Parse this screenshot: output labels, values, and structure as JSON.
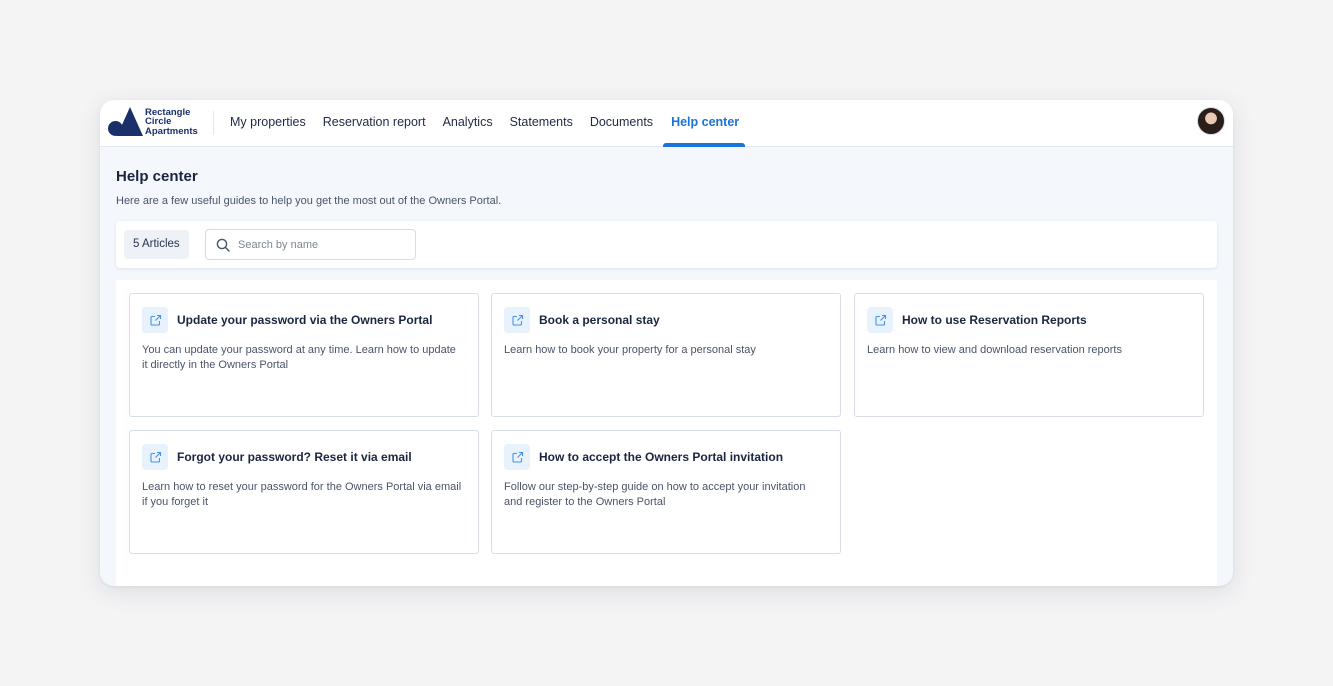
{
  "brand": {
    "logo_lines": [
      "Rectangle",
      "Circle",
      "Apartments"
    ],
    "color": "#1b2f6b"
  },
  "nav": {
    "items": [
      {
        "label": "My properties"
      },
      {
        "label": "Reservation report"
      },
      {
        "label": "Analytics"
      },
      {
        "label": "Statements"
      },
      {
        "label": "Documents"
      },
      {
        "label": "Help center",
        "active": true
      }
    ],
    "accent": "#1a73d9"
  },
  "page": {
    "title": "Help center",
    "subtitle": "Here are a few useful guides to help you get the most out of the Owners Portal."
  },
  "toolbar": {
    "count_label": "5 Articles",
    "search_placeholder": "Search by name",
    "search_value": ""
  },
  "articles": [
    {
      "title": "Update your password via the Owners Portal",
      "description": "You can update your password at any time. Learn how to update it directly in the Owners Portal",
      "icon": "external-link-icon"
    },
    {
      "title": "Book a personal stay",
      "description": "Learn how to book your property for a personal stay",
      "icon": "external-link-icon"
    },
    {
      "title": "How to use Reservation Reports",
      "description": "Learn how to view and download reservation reports",
      "icon": "external-link-icon"
    },
    {
      "title": "Forgot your password? Reset it via email",
      "description": "Learn how to reset your password for the Owners Portal via email if you forget it",
      "icon": "external-link-icon"
    },
    {
      "title": "How to accept the Owners Portal invitation",
      "description": "Follow our step-by-step guide on how to accept your invitation and register to the Owners Portal",
      "icon": "external-link-icon"
    }
  ]
}
